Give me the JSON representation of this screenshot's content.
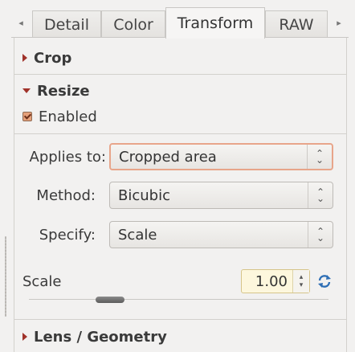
{
  "tabs": {
    "items": [
      {
        "label": "Detail"
      },
      {
        "label": "Color"
      },
      {
        "label": "Transform",
        "active": true
      },
      {
        "label": "RAW"
      }
    ],
    "left_arrow": "◂",
    "right_arrow": "▸"
  },
  "sections": {
    "crop": {
      "title": "Crop",
      "expanded": false
    },
    "resize": {
      "title": "Resize",
      "expanded": true,
      "enabled_label": "Enabled",
      "enabled": true,
      "applies_to": {
        "label": "Applies to:",
        "value": "Cropped area"
      },
      "method": {
        "label": "Method:",
        "value": "Bicubic"
      },
      "specify": {
        "label": "Specify:",
        "value": "Scale"
      },
      "scale": {
        "label": "Scale",
        "value": "1.00",
        "slider_fraction": 0.12
      }
    },
    "lens": {
      "title": "Lens / Geometry",
      "expanded": false
    }
  },
  "colors": {
    "accent": "#a0322a",
    "focus_border": "#e8a58a",
    "spin_bg": "#fdf7dd",
    "reset_icon": "#2f6fb5"
  },
  "icons": {
    "combo_arrows": "updown-chevron-icon",
    "reset": "reset-refresh-icon"
  }
}
